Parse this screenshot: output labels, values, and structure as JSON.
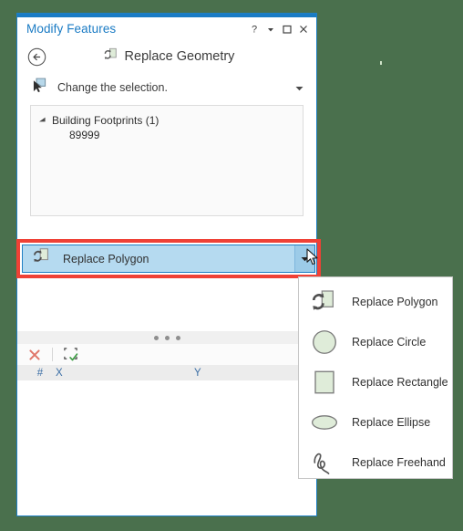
{
  "window": {
    "title": "Modify Features",
    "controls": [
      {
        "name": "help-icon",
        "glyph": "?"
      },
      {
        "name": "menu-caret-icon",
        "glyph": "▾"
      },
      {
        "name": "maximize-icon",
        "glyph": "□"
      },
      {
        "name": "close-icon",
        "glyph": "✕"
      }
    ],
    "accent_color": "#1a7bc4",
    "title_color": "#1a7bc4"
  },
  "header": {
    "back_icon": "back-arrow-icon",
    "tool_icon": "replace-geometry-icon",
    "title": "Replace Geometry"
  },
  "selection": {
    "icon": "select-pointer-icon",
    "label": "Change the selection.",
    "caret": "▾"
  },
  "tree": {
    "group": {
      "arrow": "▲",
      "label": "Building Footprints (1)"
    },
    "children": [
      {
        "label": "89999"
      }
    ]
  },
  "replace_button": {
    "icon": "replace-polygon-icon",
    "label": "Replace Polygon",
    "split_caret": "▾",
    "highlight_color": "#ef4136",
    "selected_fill": "#b5daf0"
  },
  "dropdown": {
    "items": [
      {
        "icon": "replace-polygon-icon",
        "label": "Replace Polygon"
      },
      {
        "icon": "replace-circle-icon",
        "label": "Replace Circle"
      },
      {
        "icon": "replace-rectangle-icon",
        "label": "Replace Rectangle"
      },
      {
        "icon": "replace-ellipse-icon",
        "label": "Replace Ellipse"
      },
      {
        "icon": "replace-freehand-icon",
        "label": "Replace Freehand"
      }
    ]
  },
  "vertex_toolbar": {
    "delete_icon": "delete-x-icon",
    "finish_sketch_icon": "finish-sketch-icon"
  },
  "vertex_table": {
    "columns": [
      {
        "key": "corner",
        "label": ""
      },
      {
        "key": "num",
        "label": "#"
      },
      {
        "key": "x",
        "label": "X"
      },
      {
        "key": "y",
        "label": "Y"
      }
    ],
    "rows": []
  },
  "colors": {
    "desktop_background": "#4a704d",
    "panel_border": "#1f7fc4",
    "shape_fill": "#dfecd9",
    "shape_stroke": "#6f6f6f"
  }
}
